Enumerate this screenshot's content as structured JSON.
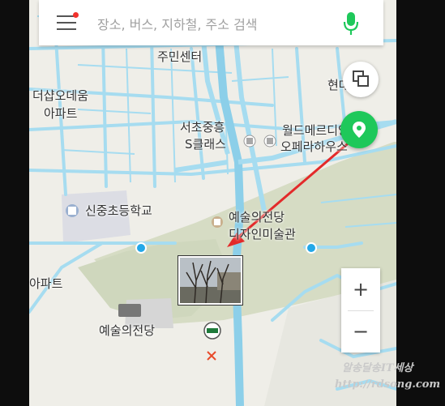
{
  "search": {
    "placeholder": "장소, 버스, 지하철, 주소 검색",
    "menu_icon": "hamburger-menu-icon",
    "mic_icon": "microphone-icon"
  },
  "map": {
    "labels": {
      "jumin_center": "주민센터",
      "the_sharp_1": "더샵오데움",
      "the_sharp_2": "아파트",
      "seocho_1": "서초중흥",
      "seocho_2": "S클래스",
      "world_1": "월드메르디앙",
      "world_2": "오페라하우스",
      "school": "신중초등학교",
      "arts_center": "예술의전당",
      "design_museum": "디자인미술관",
      "apart_left": "아파트",
      "arts_center_bottom": "예술의전당",
      "hyun_bil": "현대빌"
    }
  },
  "controls": {
    "layers_icon": "layers-icon",
    "location_icon": "location-pin-icon",
    "zoom_in_label": "+",
    "zoom_out_label": "−"
  },
  "watermark": {
    "line1": "알송달송IT세상",
    "line2": "http://rdsong.com"
  },
  "colors": {
    "accent_green": "#1ec85a",
    "road_blue": "#a6dcf0",
    "arrow_red": "#e32a2a"
  }
}
